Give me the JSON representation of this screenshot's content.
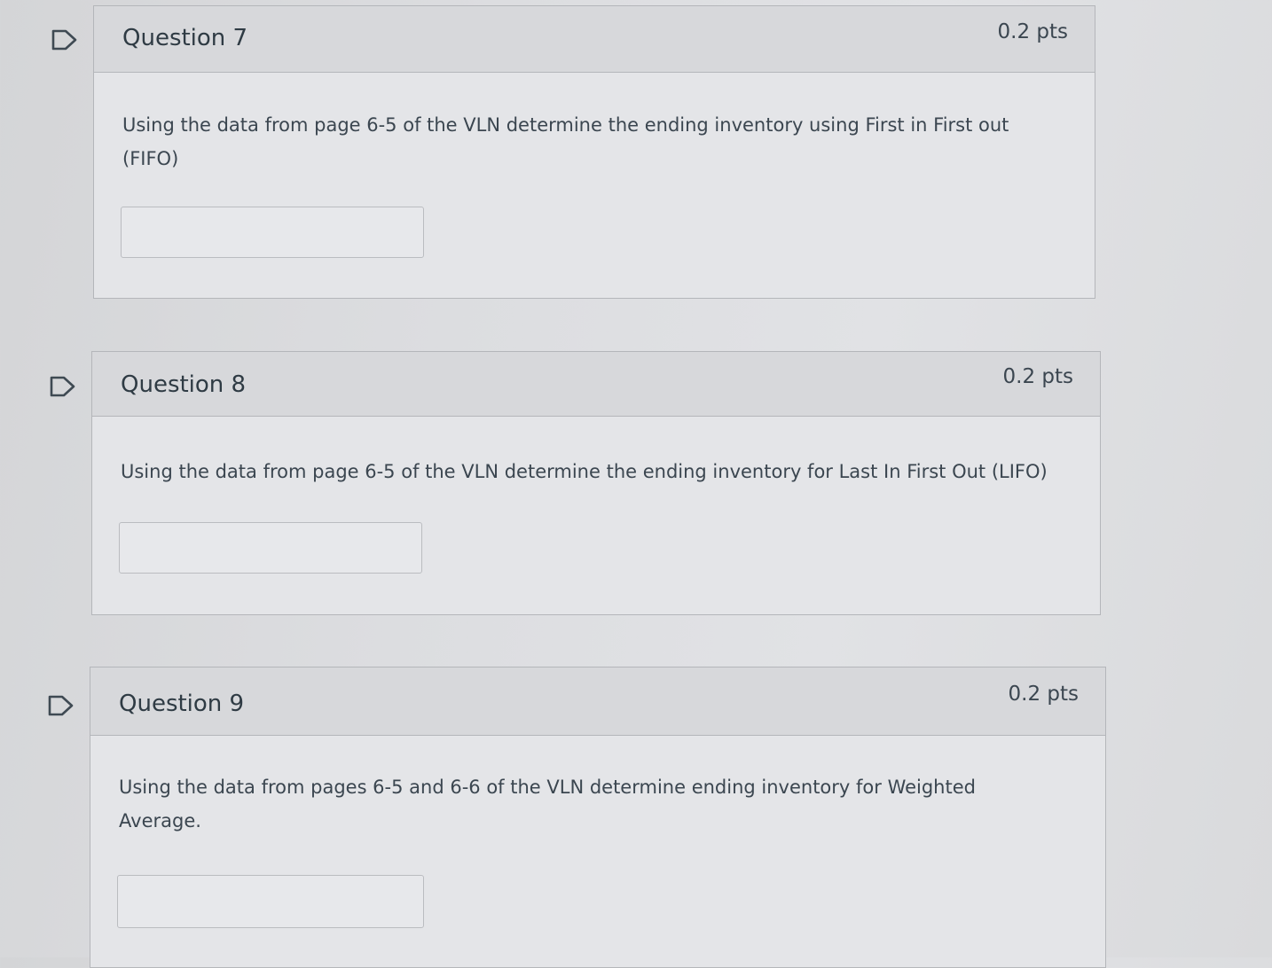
{
  "questions": [
    {
      "title": "Question 7",
      "points": "0.2 pts",
      "text": "Using the data from page 6-5 of the VLN determine the ending inventory using First in First out (FIFO)",
      "answer": ""
    },
    {
      "title": "Question 8",
      "points": "0.2 pts",
      "text": "Using the data from page 6-5 of the VLN determine the ending inventory for Last In First Out (LIFO)",
      "answer": ""
    },
    {
      "title": "Question 9",
      "points": "0.2 pts",
      "text": "Using the data from pages 6-5 and 6-6 of the VLN determine ending inventory for Weighted Average.",
      "answer": ""
    }
  ],
  "icons": {
    "flag": "flag-question-icon"
  },
  "colors": {
    "header_bg": "#d7d8db",
    "body_bg": "#e4e5e8",
    "border": "#b4b6ba",
    "text": "#2f3b44"
  }
}
